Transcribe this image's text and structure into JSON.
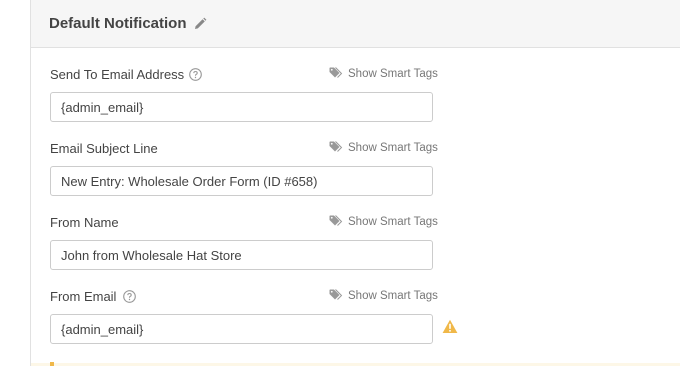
{
  "panel": {
    "title": "Default Notification"
  },
  "fields": {
    "send_to": {
      "label": "Send To Email Address",
      "value": "{admin_email}",
      "smart_tags": "Show Smart Tags"
    },
    "subject": {
      "label": "Email Subject Line",
      "value": "New Entry: Wholesale Order Form (ID #658)",
      "smart_tags": "Show Smart Tags"
    },
    "from_name": {
      "label": "From Name",
      "value": "John from Wholesale Hat Store",
      "smart_tags": "Show Smart Tags"
    },
    "from_email": {
      "label": "From Email",
      "value": "{admin_email}",
      "smart_tags": "Show Smart Tags"
    }
  },
  "icons": {
    "edit": "pencil-icon",
    "help": "question-circle-icon",
    "tag": "tag-icon",
    "warning": "warning-triangle-icon"
  },
  "colors": {
    "warning": "#f0b849",
    "label_text": "#444444",
    "muted_text": "#777777"
  }
}
